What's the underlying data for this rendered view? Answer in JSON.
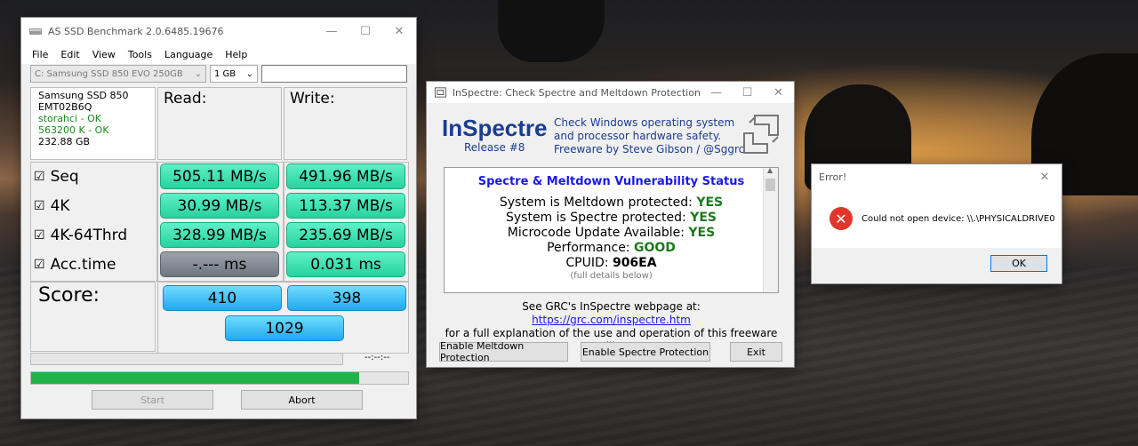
{
  "asssd": {
    "title": "AS SSD Benchmark 2.0.6485.19676",
    "menu": [
      "File",
      "Edit",
      "View",
      "Tools",
      "Language",
      "Help"
    ],
    "drive_select": "C: Samsung SSD 850 EVO 250GB",
    "size_select": "1 GB",
    "info": {
      "model": "Samsung SSD 850",
      "firmware": "EMT02B6Q",
      "driver": "storahci - OK",
      "alignment": "563200 K - OK",
      "capacity": "232.88 GB"
    },
    "headers": {
      "read": "Read:",
      "write": "Write:"
    },
    "rows": [
      {
        "label": "Seq",
        "read": "505.11 MB/s",
        "write": "491.96 MB/s"
      },
      {
        "label": "4K",
        "read": "30.99 MB/s",
        "write": "113.37 MB/s"
      },
      {
        "label": "4K-64Thrd",
        "read": "328.99 MB/s",
        "write": "235.69 MB/s"
      },
      {
        "label": "Acc.time",
        "read": "-.--- ms",
        "write": "0.031 ms"
      }
    ],
    "score_label": "Score:",
    "score": {
      "read": "410",
      "write": "398",
      "total": "1029"
    },
    "time_text": "--:--:--",
    "progress_fraction": 0.87,
    "start_label": "Start",
    "abort_label": "Abort"
  },
  "inspectre": {
    "title": "InSpectre: Check Spectre and Meltdown Protection",
    "app_name": "InSpectre",
    "release": "Release #8",
    "description": [
      "Check Windows operating system",
      "and processor hardware safety.",
      "Freeware by Steve Gibson / @Sggrc"
    ],
    "status_title": "Spectre & Meltdown Vulnerability Status",
    "status_lines": [
      {
        "label": "System is Meltdown protected:",
        "value": "YES"
      },
      {
        "label": "System is Spectre protected:",
        "value": "YES"
      },
      {
        "label": "Microcode Update Available:",
        "value": "YES"
      },
      {
        "label": "Performance:",
        "value": "GOOD"
      },
      {
        "label": "CPUID:",
        "value": "906EA"
      }
    ],
    "details_note": "(full details below)",
    "webpage_prefix": "See GRC's InSpectre webpage at:",
    "webpage_url": "https://grc.com/inspectre.htm",
    "webpage_suffix": "for a full explanation of the use and operation of this freeware utility.",
    "buttons": {
      "meltdown": "Enable Meltdown Protection",
      "spectre": "Enable Spectre Protection",
      "exit": "Exit"
    }
  },
  "error_dialog": {
    "title": "Error!",
    "message": "Could not open device: \\\\.\\PHYSICALDRIVE0",
    "ok_label": "OK"
  },
  "colors": {
    "score_blue": "#21a9ee",
    "result_green": "#27d29e",
    "progress_green": "#22b24c",
    "error_red": "#e0362b"
  }
}
